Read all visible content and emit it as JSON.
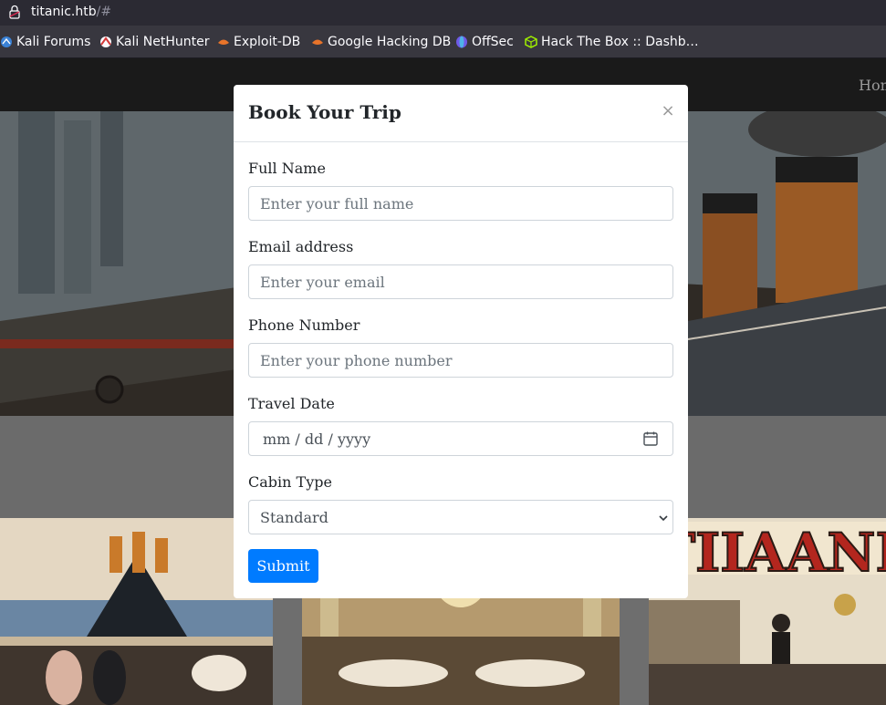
{
  "browser": {
    "url_host": "titanic.htb",
    "url_path": "/#",
    "bookmarks": [
      {
        "label": "Kali Forums",
        "icon": "kali-forums-icon",
        "color": "#3b82d6"
      },
      {
        "label": "Kali NetHunter",
        "icon": "kali-nethunter-icon",
        "color": "#d43a3a"
      },
      {
        "label": "Exploit-DB",
        "icon": "exploit-db-icon",
        "color": "#e8742a"
      },
      {
        "label": "Google Hacking DB",
        "icon": "google-hacking-db-icon",
        "color": "#e8742a"
      },
      {
        "label": "OffSec",
        "icon": "offsec-icon",
        "color": "#6f5ae8"
      },
      {
        "label": "Hack The Box :: Dashb…",
        "icon": "hack-the-box-icon",
        "color": "#9fef00"
      }
    ]
  },
  "page": {
    "nav_home": "Hom"
  },
  "modal": {
    "title": "Book Your Trip",
    "close_label": "×",
    "fields": {
      "full_name": {
        "label": "Full Name",
        "placeholder": "Enter your full name"
      },
      "email": {
        "label": "Email address",
        "placeholder": "Enter your email"
      },
      "phone": {
        "label": "Phone Number",
        "placeholder": "Enter your phone number"
      },
      "travel_date": {
        "label": "Travel Date",
        "placeholder": "mm / dd / yyyy"
      },
      "cabin_type": {
        "label": "Cabin Type",
        "selected": "Standard"
      }
    },
    "submit_label": "Submit",
    "accent_color": "#007bff"
  }
}
